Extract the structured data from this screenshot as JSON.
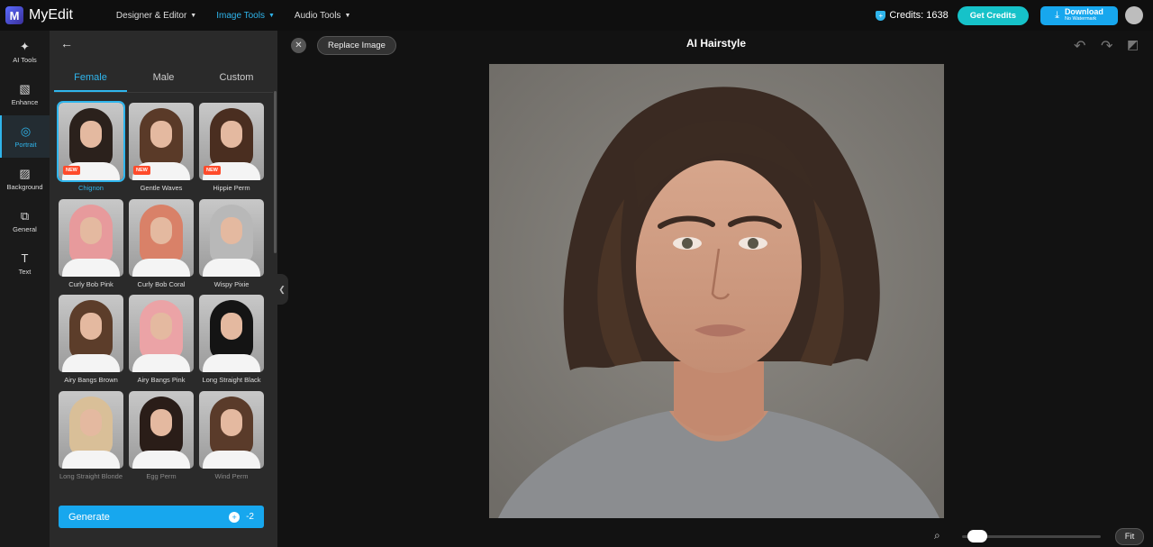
{
  "app": {
    "name": "MyEdit",
    "logo_letter": "M"
  },
  "nav": [
    {
      "label": "Designer & Editor",
      "active": false
    },
    {
      "label": "Image Tools",
      "active": true
    },
    {
      "label": "Audio Tools",
      "active": false
    }
  ],
  "credits": {
    "label": "Credits: 1638"
  },
  "buttons": {
    "get_credits": "Get Credits",
    "download": "Download",
    "download_sub": "No Watermark",
    "replace": "Replace Image",
    "fit": "Fit",
    "generate": "Generate",
    "generate_cost": "-2"
  },
  "rail": [
    {
      "label": "AI Tools",
      "icon": "magic-wand-icon",
      "glyph": "✦",
      "active": false
    },
    {
      "label": "Enhance",
      "icon": "enhance-icon",
      "glyph": "▧",
      "active": false
    },
    {
      "label": "Portrait",
      "icon": "portrait-icon",
      "glyph": "◎",
      "active": true
    },
    {
      "label": "Background",
      "icon": "background-icon",
      "glyph": "▨",
      "active": false
    },
    {
      "label": "General",
      "icon": "general-icon",
      "glyph": "⧉",
      "active": false
    },
    {
      "label": "Text",
      "icon": "text-icon",
      "glyph": "T",
      "active": false
    }
  ],
  "tabs": [
    {
      "label": "Female",
      "active": true
    },
    {
      "label": "Male",
      "active": false
    },
    {
      "label": "Custom",
      "active": false
    }
  ],
  "styles": [
    {
      "label": "Chignon",
      "new": true,
      "selected": true,
      "hair": "#2b211c"
    },
    {
      "label": "Gentle Waves",
      "new": true,
      "selected": false,
      "hair": "#5a3a28"
    },
    {
      "label": "Hippie Perm",
      "new": true,
      "selected": false,
      "hair": "#4a2e20"
    },
    {
      "label": "Curly Bob Pink",
      "new": false,
      "selected": false,
      "hair": "#e79a9c"
    },
    {
      "label": "Curly Bob Coral",
      "new": false,
      "selected": false,
      "hair": "#d98168"
    },
    {
      "label": "Wispy Pixie",
      "new": false,
      "selected": false,
      "hair": "#b8b8b8"
    },
    {
      "label": "Airy Bangs Brown",
      "new": false,
      "selected": false,
      "hair": "#5c3d2a"
    },
    {
      "label": "Airy Bangs Pink",
      "new": false,
      "selected": false,
      "hair": "#eba3a6"
    },
    {
      "label": "Long Straight Black",
      "new": false,
      "selected": false,
      "hair": "#141414"
    },
    {
      "label": "Long Straight Blonde",
      "new": false,
      "selected": false,
      "hair": "#d9bf98",
      "faded": true
    },
    {
      "label": "Egg Perm",
      "new": false,
      "selected": false,
      "hair": "#2a1d18",
      "faded": true
    },
    {
      "label": "Wind Perm",
      "new": false,
      "selected": false,
      "hair": "#5a3b2a",
      "faded": true
    }
  ],
  "new_badge": "NEW",
  "canvas": {
    "title": "AI Hairstyle"
  },
  "zoom": {
    "level": 0.05
  },
  "colors": {
    "accent": "#2fb5ec",
    "badge": "#ff4b2b",
    "get_credits": "#16c2c9"
  }
}
